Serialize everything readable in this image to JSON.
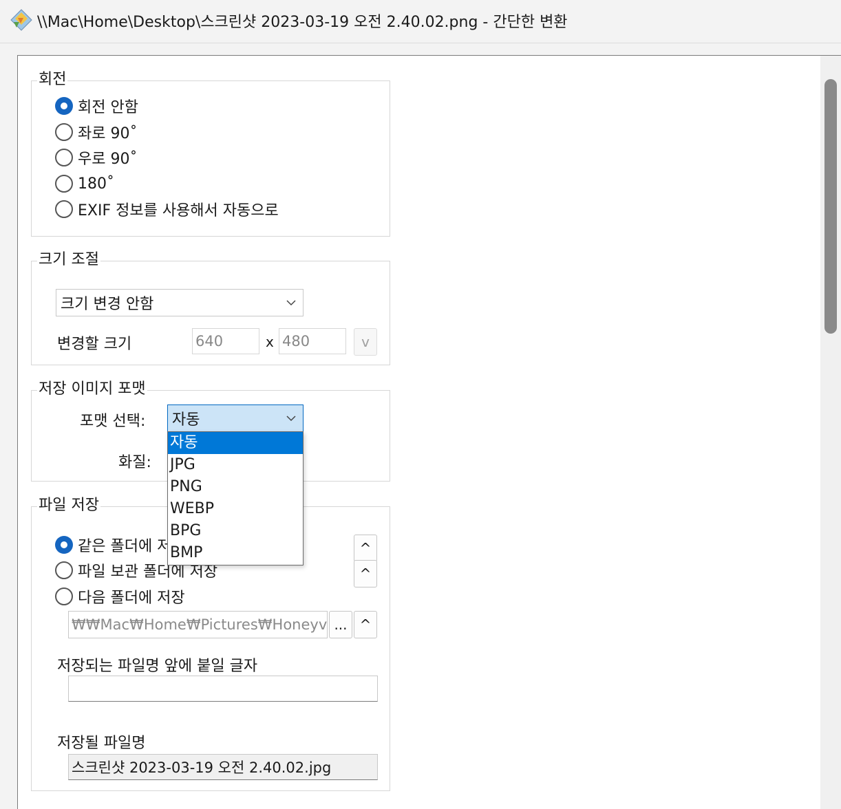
{
  "window": {
    "title": "\\\\Mac\\Home\\Desktop\\스크린샷 2023-03-19 오전 2.40.02.png - 간단한 변환",
    "icon": "honeyview-app-icon"
  },
  "rotation": {
    "label": "회전",
    "options": [
      "회전 안함",
      "좌로 90˚",
      "우로 90˚",
      "180˚",
      "EXIF 정보를 사용해서 자동으로"
    ],
    "selected_index": 0
  },
  "resize": {
    "label": "크기 조절",
    "mode_value": "크기 변경 안함",
    "size_label": "변경할 크기",
    "width": "640",
    "x_label": "x",
    "height": "480",
    "apply_label": "v"
  },
  "format": {
    "label": "저장 이미지 포맷",
    "select_label": "포맷 선택:",
    "select_value": "자동",
    "quality_label": "화질:",
    "options": [
      "자동",
      "JPG",
      "PNG",
      "WEBP",
      "BPG",
      "BMP"
    ],
    "highlighted_index": 0
  },
  "save": {
    "label": "파일 저장",
    "options": [
      "같은 폴더에 저장",
      "파일 보관 폴더에 저장",
      "다음 폴더에 저장"
    ],
    "selected_index": 0,
    "folder_path": "₩₩Mac₩Home₩Pictures₩Honeyvi",
    "browse_label": "...",
    "up_label": "^",
    "prefix_label": "저장되는 파일명 앞에 붙일 글자",
    "prefix_value": "",
    "result_label": "저장될 파일명",
    "result_value": "스크린샷 2023-03-19 오전 2.40.02.jpg"
  },
  "colors": {
    "accent": "#0078d7",
    "radio_checked": "#1565c0",
    "open_select_bg": "#cce4f7"
  }
}
